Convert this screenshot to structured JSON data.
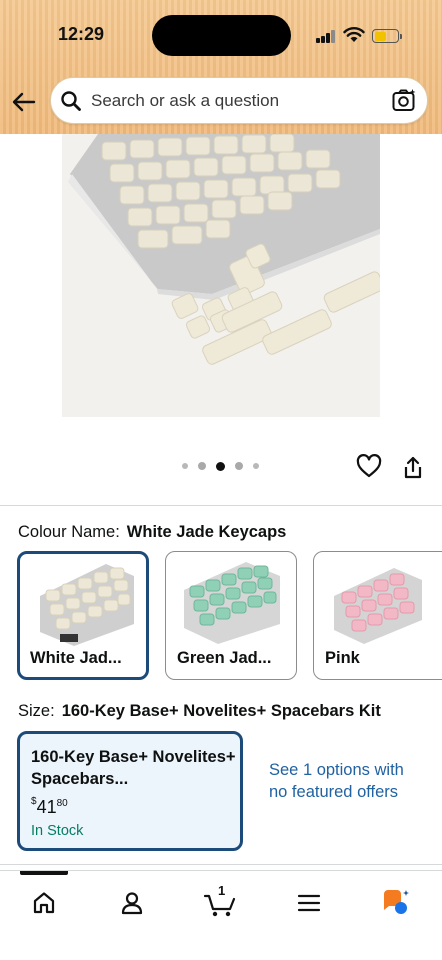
{
  "status_bar": {
    "time": "12:29"
  },
  "search": {
    "placeholder": "Search or ask a question"
  },
  "product": {
    "carousel_total": 5,
    "carousel_active_index": 2
  },
  "colour": {
    "label": "Colour Name:",
    "value": "White Jade Keycaps",
    "options": [
      {
        "name": "White Jad...",
        "selected": true
      },
      {
        "name": "Green Jad...",
        "selected": false
      },
      {
        "name": "Pink",
        "selected": false
      }
    ]
  },
  "size": {
    "label": "Size:",
    "value": "160-Key Base+ Novelites+ Spacebars Kit",
    "card_title": "160-Key Base+ Novelites+ Spacebars...",
    "price_symbol": "$",
    "price_whole": "41",
    "price_fraction": "80",
    "stock": "In Stock",
    "see_options": "See 1 options with no featured offers"
  },
  "nav": {
    "cart_count": "1"
  },
  "colors": {
    "header_bg": "#f0b97a",
    "selected_border": "#1c4b7a",
    "link": "#2162a1",
    "in_stock": "#067d62",
    "size_card_bg": "#edf5fc"
  }
}
